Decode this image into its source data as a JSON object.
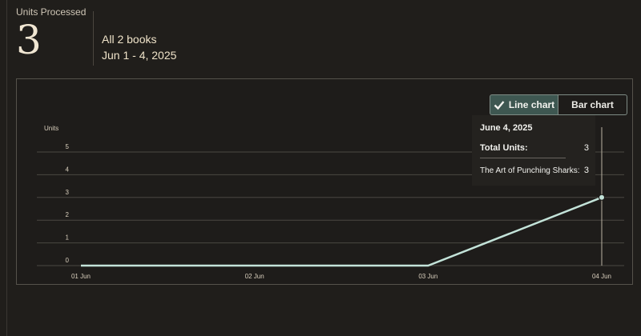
{
  "summary": {
    "label": "Units Processed",
    "value": "3",
    "books": "All 2 books",
    "dates": "Jun 1 - 4, 2025"
  },
  "toggle": {
    "line_label": "Line chart",
    "bar_label": "Bar chart",
    "selected": "line"
  },
  "tooltip": {
    "date": "June 4, 2025",
    "total_label": "Total Units:",
    "total_value": "3",
    "title_label": "The Art of Punching Sharks:",
    "title_value": "3"
  },
  "colors": {
    "line": "#c3e3d9",
    "grid": "#4a4742",
    "accent": "#3e5751"
  },
  "chart_data": {
    "type": "line",
    "ylabel": "Units",
    "categories": [
      "01 Jun",
      "02 Jun",
      "03 Jun",
      "04 Jun"
    ],
    "yticks": [
      "0",
      "1",
      "2",
      "3",
      "4",
      "5"
    ],
    "ylim": [
      0,
      5
    ],
    "series": [
      {
        "values": [
          0,
          0,
          0,
          3
        ]
      }
    ],
    "highlighted_index": 3,
    "grid": true
  }
}
